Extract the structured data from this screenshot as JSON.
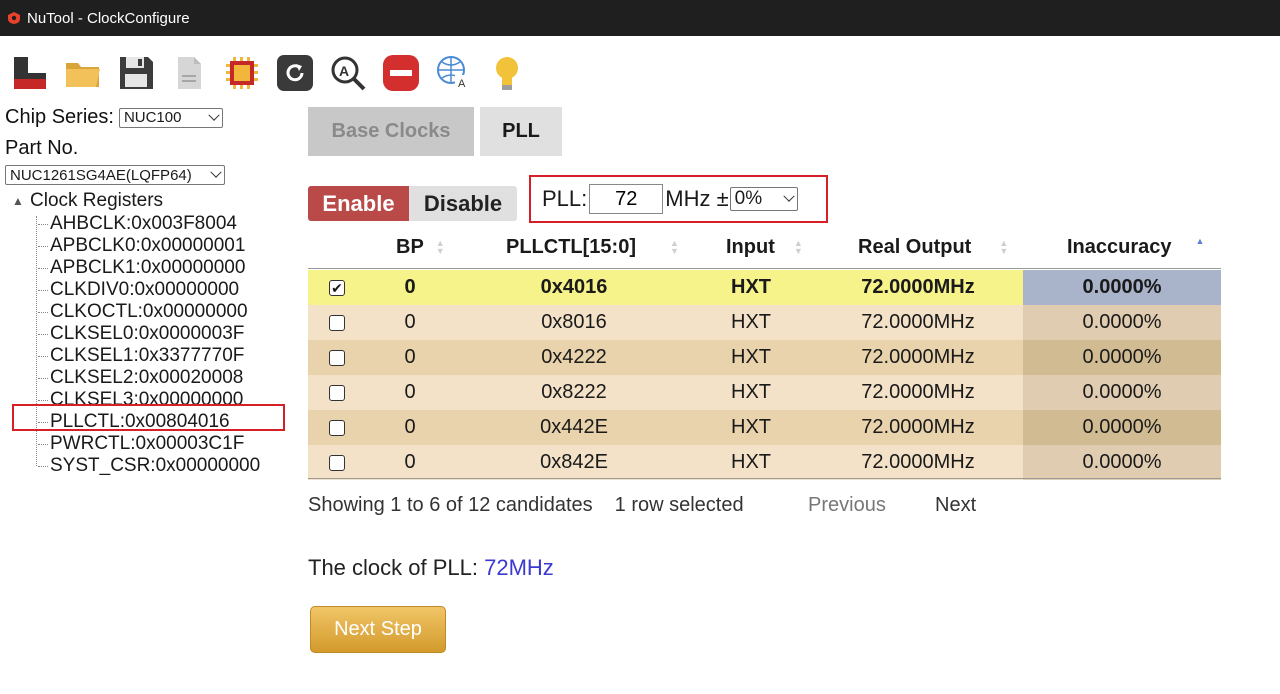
{
  "window": {
    "title": "NuTool - ClockConfigure"
  },
  "toolbar": {
    "icons": [
      "build-icon",
      "open-folder-icon",
      "save-icon",
      "document-icon",
      "chip-icon",
      "reset-icon",
      "zoom-search-icon",
      "stop-icon",
      "language-globe-icon",
      "tip-lightbulb-icon"
    ]
  },
  "sidebar": {
    "chip_series_label": "Chip Series:",
    "chip_series_value": "NUC100",
    "part_no_label": "Part No.",
    "part_no_value": "NUC1261SG4AE(LQFP64)",
    "tree_root": "Clock Registers",
    "registers": [
      "AHBCLK:0x003F8004",
      "APBCLK0:0x00000001",
      "APBCLK1:0x00000000",
      "CLKDIV0:0x00000000",
      "CLKOCTL:0x00000000",
      "CLKSEL0:0x0000003F",
      "CLKSEL1:0x3377770F",
      "CLKSEL2:0x00020008",
      "CLKSEL3:0x00000000",
      "PLLCTL:0x00804016",
      "PWRCTL:0x00003C1F",
      "SYST_CSR:0x00000000"
    ],
    "highlighted_register_index": 9
  },
  "tabs": [
    {
      "label": "Base Clocks",
      "active": false
    },
    {
      "label": "PLL",
      "active": true
    }
  ],
  "controls": {
    "enable_label": "Enable",
    "disable_label": "Disable",
    "pll_label": "PLL:",
    "pll_value": "72",
    "mhz_label": "MHz ±",
    "tolerance_value": "0%"
  },
  "table": {
    "columns": [
      "BP",
      "PLLCTL[15:0]",
      "Input",
      "Real Output",
      "Inaccuracy"
    ],
    "rows": [
      {
        "checked": true,
        "bp": "0",
        "pllctl": "0x4016",
        "input": "HXT",
        "output": "72.0000MHz",
        "inaccuracy": "0.0000%"
      },
      {
        "checked": false,
        "bp": "0",
        "pllctl": "0x8016",
        "input": "HXT",
        "output": "72.0000MHz",
        "inaccuracy": "0.0000%"
      },
      {
        "checked": false,
        "bp": "0",
        "pllctl": "0x4222",
        "input": "HXT",
        "output": "72.0000MHz",
        "inaccuracy": "0.0000%"
      },
      {
        "checked": false,
        "bp": "0",
        "pllctl": "0x8222",
        "input": "HXT",
        "output": "72.0000MHz",
        "inaccuracy": "0.0000%"
      },
      {
        "checked": false,
        "bp": "0",
        "pllctl": "0x442E",
        "input": "HXT",
        "output": "72.0000MHz",
        "inaccuracy": "0.0000%"
      },
      {
        "checked": false,
        "bp": "0",
        "pllctl": "0x842E",
        "input": "HXT",
        "output": "72.0000MHz",
        "inaccuracy": "0.0000%"
      }
    ],
    "info": "Showing 1 to 6 of 12 candidates",
    "selection_info": "1 row selected",
    "previous_label": "Previous",
    "next_label": "Next"
  },
  "result": {
    "prefix": "The clock of PLL: ",
    "value": "72MHz"
  },
  "next_step_label": "Next Step",
  "colors": {
    "titlebar_bg": "#1f1f1f",
    "enable_bg": "#b94a48",
    "highlight_red": "#d42026",
    "selected_row_bg": "#f6f38a",
    "selected_sort_cell_bg": "#a9b3c9",
    "row_light": "#f3e2c8",
    "row_dark": "#e9d3ac",
    "sort_cell_light": "#e0ccb0",
    "sort_cell_dark": "#d1bb92",
    "link_blue": "#3a3ad0",
    "button_gold": "#e0a73c"
  }
}
